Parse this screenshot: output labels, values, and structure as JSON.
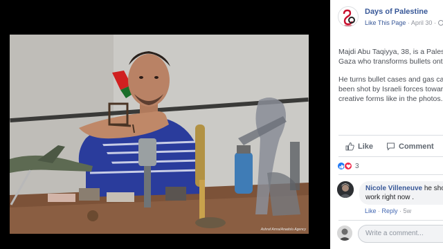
{
  "photo": {
    "credit": "Ashraf Amra/Anadolu Agency"
  },
  "post": {
    "page_name": "Days of Palestine",
    "like_this_page": "Like This Page",
    "separator": "·",
    "date": "April 30",
    "paragraph1_line1": "Majdi Abu Taqiyya, 38, is a Pales",
    "paragraph1_line2": "Gaza who transforms bullets ont",
    "paragraph2_line1": "He turns bullet cases and gas ca",
    "paragraph2_line2": "been shot by Israeli forces towar",
    "paragraph2_line3": "creative forms like in the photos."
  },
  "actions": {
    "like_label": "Like",
    "comment_label": "Comment"
  },
  "reactions": {
    "count": "3",
    "types": [
      "like",
      "love"
    ]
  },
  "comment": {
    "author": "Nicole Villeneuve",
    "text_line1": " he shou",
    "text_line2": "work right now .",
    "like_label": "Like",
    "dot": "·",
    "reply_label": "Reply",
    "time": "5w"
  },
  "composer": {
    "placeholder": "Write a comment..."
  },
  "colors": {
    "link_blue": "#385898",
    "like_reaction": "#2078f4",
    "love_reaction": "#f0284a"
  }
}
